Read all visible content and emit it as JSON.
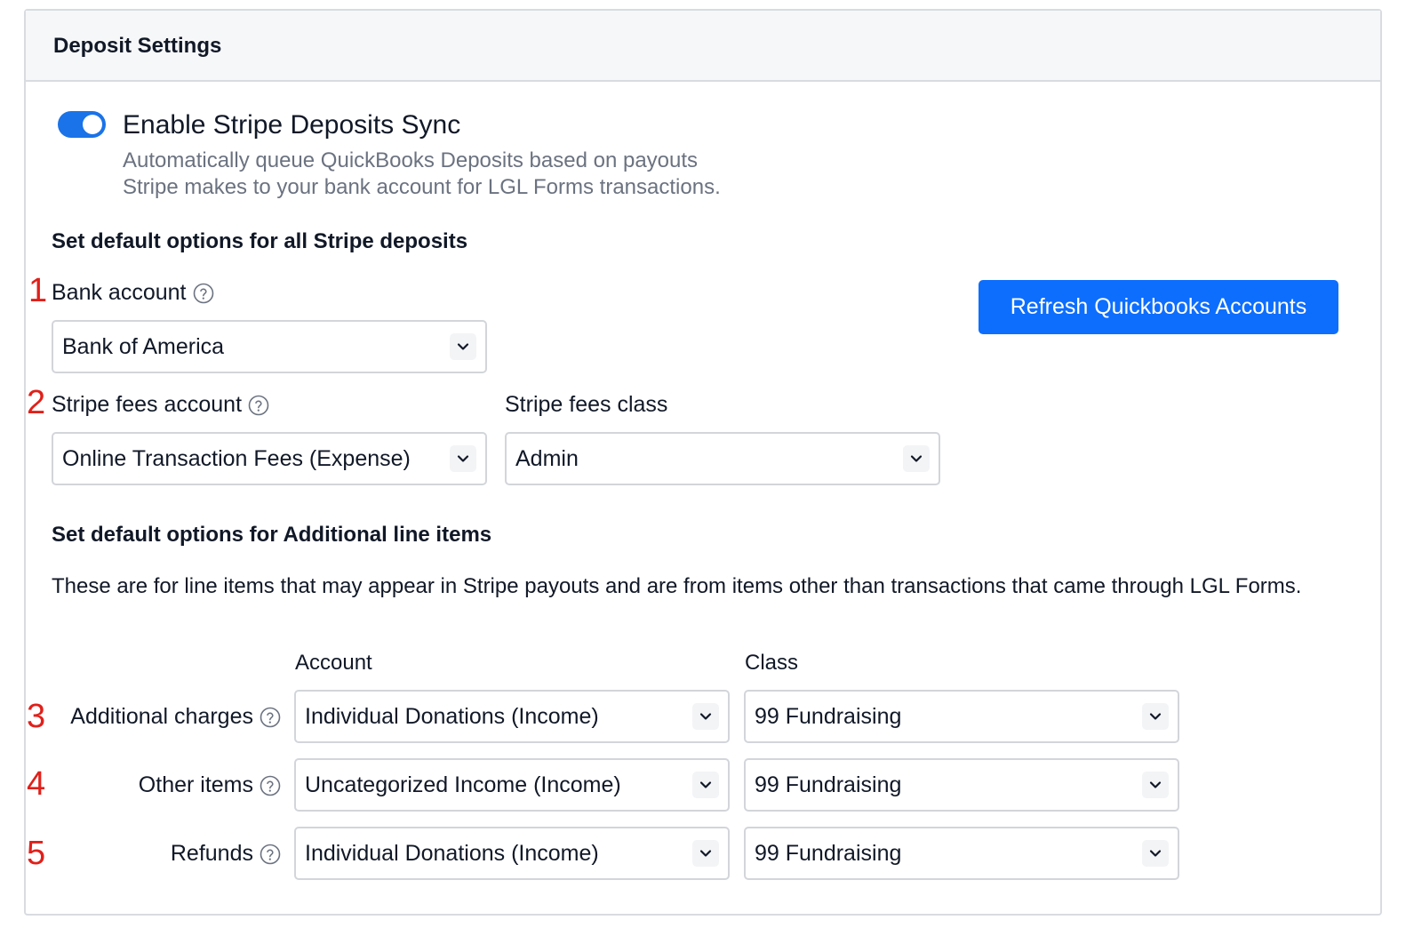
{
  "panel": {
    "title": "Deposit Settings"
  },
  "toggle": {
    "label": "Enable Stripe Deposits Sync",
    "enabled": true,
    "description_line1": "Automatically queue QuickBooks Deposits based on payouts",
    "description_line2": "Stripe makes to your bank account for LGL Forms transactions."
  },
  "stripe_defaults": {
    "title": "Set default options for all Stripe deposits",
    "bank_account": {
      "marker": "1",
      "label": "Bank account",
      "value": "Bank of America"
    },
    "refresh_button": "Refresh Quickbooks Accounts",
    "fees_account": {
      "marker": "2",
      "label": "Stripe fees account",
      "value": "Online Transaction Fees (Expense)"
    },
    "fees_class": {
      "label": "Stripe fees class",
      "value": "Admin"
    }
  },
  "additional": {
    "title": "Set default options for Additional line items",
    "description": "These are for line items that may appear in Stripe payouts and are from items other than transactions that came through LGL Forms.",
    "col_account": "Account",
    "col_class": "Class",
    "rows": [
      {
        "marker": "3",
        "label": "Additional charges",
        "account": "Individual Donations (Income)",
        "class": "99 Fundraising"
      },
      {
        "marker": "4",
        "label": "Other items",
        "account": "Uncategorized Income (Income)",
        "class": "99 Fundraising"
      },
      {
        "marker": "5",
        "label": "Refunds",
        "account": "Individual Donations (Income)",
        "class": "99 Fundraising"
      }
    ]
  },
  "colors": {
    "accent": "#0d6efd",
    "marker": "#e0201a",
    "muted": "#6b7280"
  }
}
